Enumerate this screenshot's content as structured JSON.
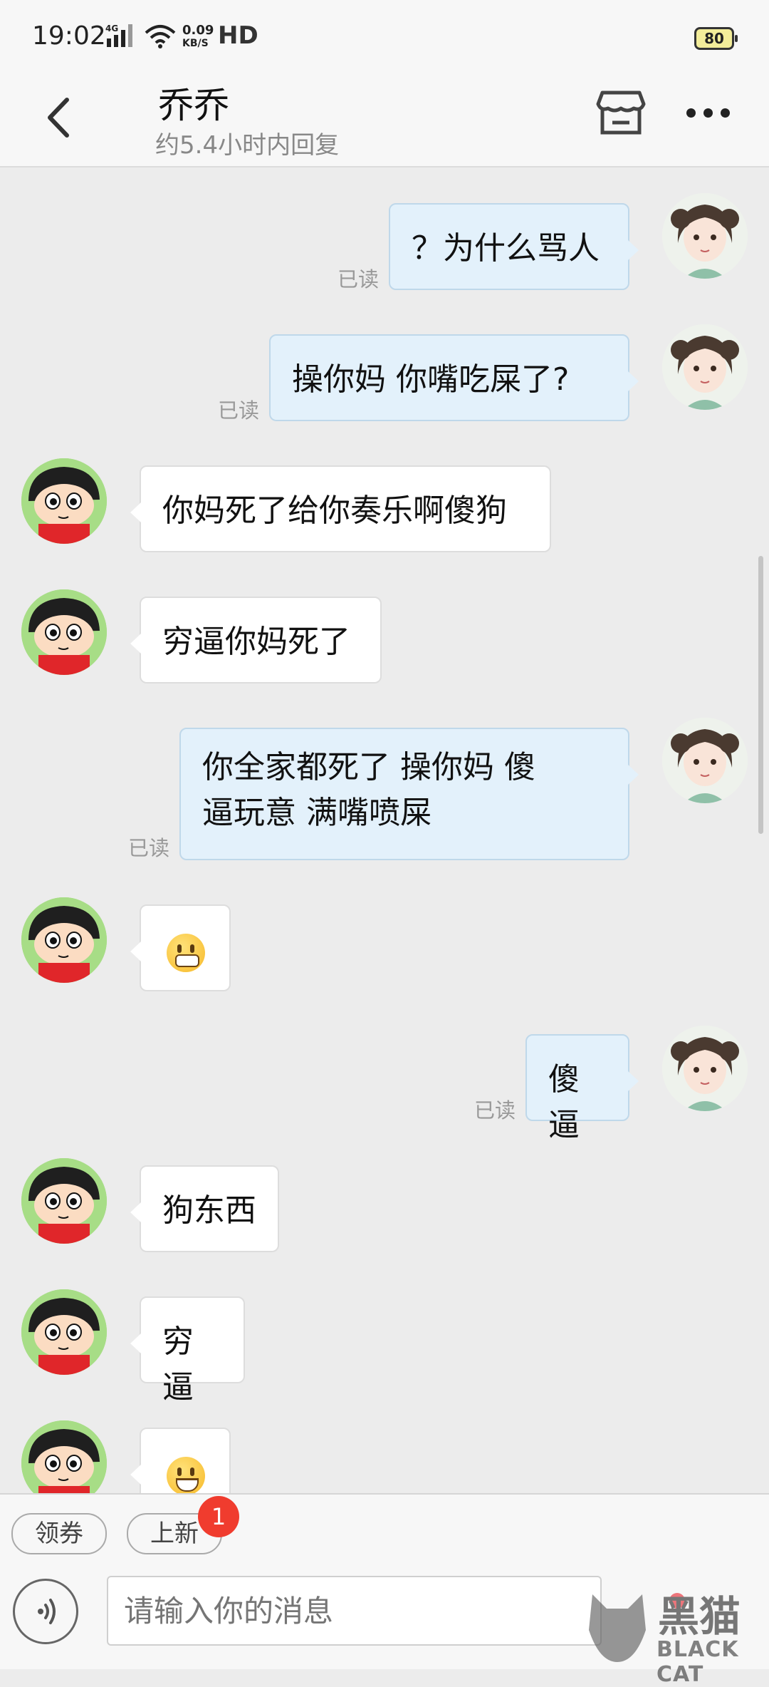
{
  "status_bar": {
    "time": "19:02",
    "network": "4G",
    "speed_value": "0.09",
    "speed_unit": "KB/S",
    "hd": "HD",
    "battery": "80"
  },
  "header": {
    "contact_name": "乔乔",
    "reply_hint": "约5.4小时内回复",
    "back_icon": "chevron-left-icon",
    "store_icon": "store-icon",
    "more_icon": "more-dots-icon"
  },
  "messages": [
    {
      "side": "right",
      "text": "？为什么骂人",
      "status": "已读"
    },
    {
      "side": "right",
      "text": "操你妈  你嘴吃屎了?",
      "status": "已读"
    },
    {
      "side": "left",
      "text": "你妈死了给你奏乐啊傻狗"
    },
    {
      "side": "left",
      "text": "穷逼你妈死了"
    },
    {
      "side": "right",
      "line1": "你全家都死了  操你妈   傻",
      "line2": "逼玩意    满嘴喷屎",
      "status": "已读"
    },
    {
      "side": "left",
      "emoji": "grimacing-face-icon"
    },
    {
      "side": "right",
      "text": "傻逼",
      "status": "已读"
    },
    {
      "side": "left",
      "text": "狗东西"
    },
    {
      "side": "left",
      "text": "穷逼"
    },
    {
      "side": "left",
      "emoji": "grinning-face-icon"
    }
  ],
  "bottom": {
    "chip_coupon": "领券",
    "chip_new": "上新",
    "badge_count": "1",
    "input_placeholder": "请输入你的消息",
    "voice_icon": "voice-icon",
    "watermark_cn": "黑猫",
    "watermark_en": "BLACK CAT"
  }
}
